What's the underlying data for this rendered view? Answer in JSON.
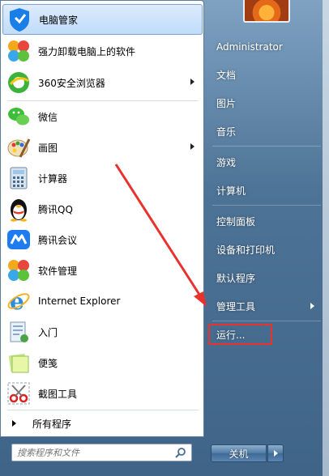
{
  "left_pane": {
    "programs": [
      {
        "label": "电脑管家",
        "icon": "tencent-pc-manager-icon",
        "selected": true,
        "arrow": false
      },
      {
        "label": "强力卸载电脑上的软件",
        "icon": "uninstaller-icon",
        "selected": false,
        "arrow": false
      },
      {
        "label": "360安全浏览器",
        "icon": "360-browser-icon",
        "selected": false,
        "arrow": true
      },
      {
        "label": "微信",
        "icon": "wechat-icon",
        "selected": false,
        "arrow": false
      },
      {
        "label": "画图",
        "icon": "paint-icon",
        "selected": false,
        "arrow": true
      },
      {
        "label": "计算器",
        "icon": "calculator-icon",
        "selected": false,
        "arrow": false
      },
      {
        "label": "腾讯QQ",
        "icon": "qq-penguin-icon",
        "selected": false,
        "arrow": false
      },
      {
        "label": "腾讯会议",
        "icon": "tencent-meeting-icon",
        "selected": false,
        "arrow": false
      },
      {
        "label": "软件管理",
        "icon": "software-manager-icon",
        "selected": false,
        "arrow": false
      },
      {
        "label": "Internet Explorer",
        "icon": "internet-explorer-icon",
        "selected": false,
        "arrow": false
      },
      {
        "label": "入门",
        "icon": "getting-started-icon",
        "selected": false,
        "arrow": false
      },
      {
        "label": "便笺",
        "icon": "sticky-notes-icon",
        "selected": false,
        "arrow": false
      },
      {
        "label": "截图工具",
        "icon": "snipping-tool-icon",
        "selected": false,
        "arrow": false
      }
    ],
    "all_programs_label": "所有程序",
    "search_placeholder": "搜索程序和文件"
  },
  "right_pane": {
    "items": [
      {
        "label": "Administrator",
        "arrow": false
      },
      {
        "label": "文档",
        "arrow": false
      },
      {
        "label": "图片",
        "arrow": false
      },
      {
        "label": "音乐",
        "arrow": false
      },
      {
        "label": "游戏",
        "arrow": false
      },
      {
        "label": "计算机",
        "arrow": false
      },
      {
        "label": "控制面板",
        "arrow": false
      },
      {
        "label": "设备和打印机",
        "arrow": false
      },
      {
        "label": "默认程序",
        "arrow": false
      },
      {
        "label": "管理工具",
        "arrow": true
      },
      {
        "label": "运行...",
        "arrow": false
      }
    ],
    "shutdown_label": "关机"
  },
  "annotation": {
    "color": "#e8322d",
    "target": "运行..."
  }
}
